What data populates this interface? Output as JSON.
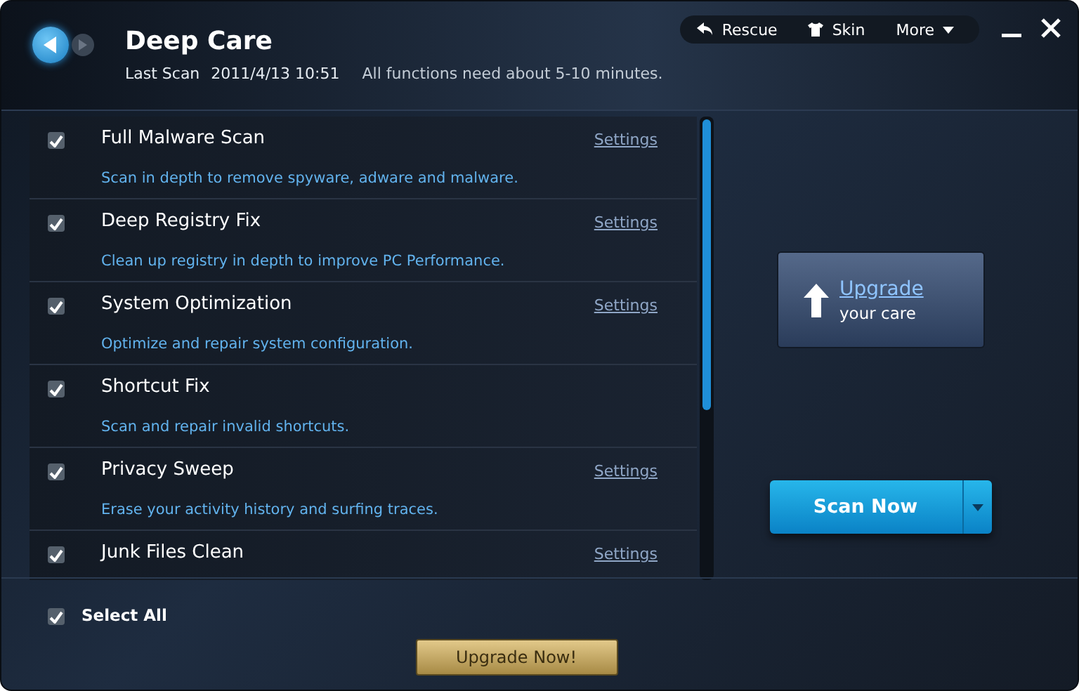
{
  "window": {
    "title": "Deep Care",
    "last_scan_label": "Last Scan",
    "last_scan_time": "2011/4/13 10:51",
    "note": "All functions need about 5-10 minutes."
  },
  "toolbar": [
    {
      "label": "Rescue",
      "kind": "rescue"
    },
    {
      "label": "Skin",
      "kind": "skin"
    },
    {
      "label": "More",
      "kind": "more"
    }
  ],
  "items": [
    {
      "title": "Full Malware Scan",
      "description": "Scan in depth to remove spyware, adware and malware.",
      "settings": "Settings",
      "checked": true
    },
    {
      "title": "Deep Registry Fix",
      "description": "Clean up registry in depth to improve PC Performance.",
      "settings": "Settings",
      "checked": true
    },
    {
      "title": "System Optimization",
      "description": "Optimize and repair system configuration.",
      "settings": "Settings",
      "checked": true
    },
    {
      "title": "Shortcut Fix",
      "description": "Scan and repair invalid shortcuts.",
      "checked": true
    },
    {
      "title": "Privacy Sweep",
      "description": "Erase your activity history and surfing traces.",
      "settings": "Settings",
      "checked": true
    },
    {
      "title": "Junk Files Clean",
      "settings": "Settings",
      "checked": true
    }
  ],
  "upgrade_card": {
    "link": "Upgrade",
    "text": "your care"
  },
  "scan_button": "Scan Now",
  "select_all": {
    "label": "Select All",
    "checked": true
  },
  "upgrade_button": "Upgrade Now!"
}
